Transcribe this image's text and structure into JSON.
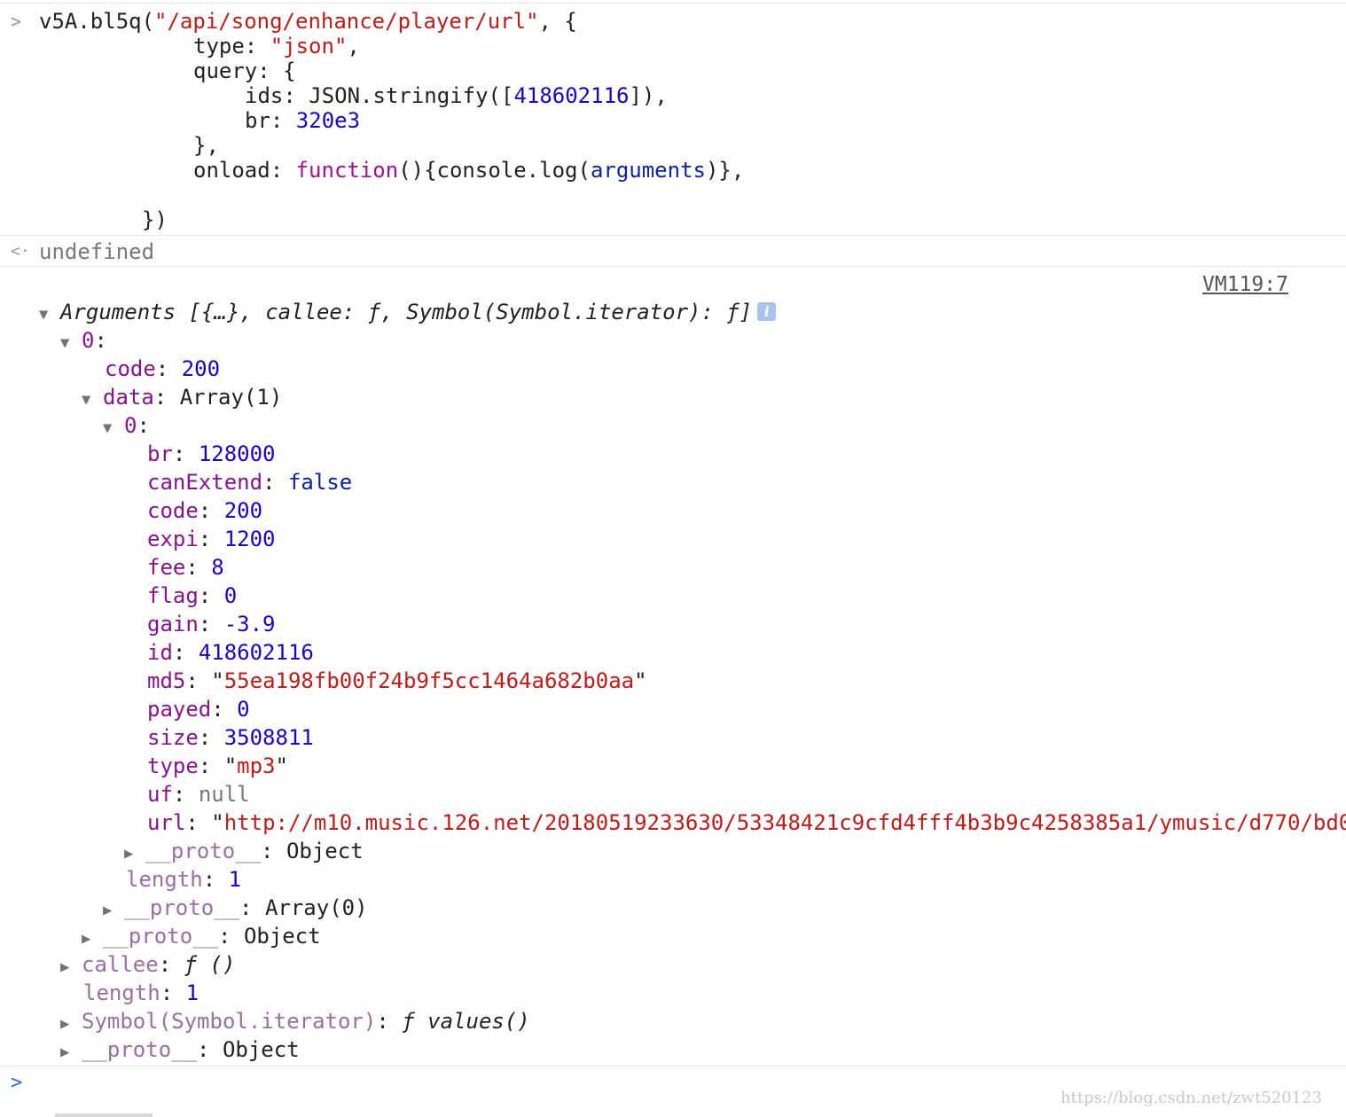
{
  "input": {
    "l1_fn": "v5A.bl5q(",
    "l1_path": "\"/api/song/enhance/player/url\"",
    "l1_end": ", {",
    "l2_key": "type: ",
    "l2_val": "\"json\"",
    "l2_end": ",",
    "l3": "query: {",
    "l4_a": "ids: JSON.stringify([",
    "l4_num": "418602116",
    "l4_b": "]),",
    "l5_key": "br: ",
    "l5_num": "320e3",
    "l6": "},",
    "l7_key": "onload: ",
    "l7_fn": "function",
    "l7_a": "(){console.log(",
    "l7_args": "arguments",
    "l7_b": ")},",
    "l8": "})"
  },
  "result": {
    "value": "undefined"
  },
  "log": {
    "source": "VM119:7",
    "summary": "Arguments [{…}, callee: ƒ, Symbol(Symbol.iterator): ƒ]",
    "info_icon": "i",
    "root_key": "0",
    "code_key": "code",
    "code_val": "200",
    "data_key": "data",
    "data_val": "Array(1)",
    "item_key": "0",
    "fields": {
      "br": "128000",
      "canExtend": "false",
      "code": "200",
      "expi": "1200",
      "fee": "8",
      "flag": "0",
      "gain": "-3.9",
      "id": "418602116",
      "md5": "55ea198fb00f24b9f5cc1464a682b0aa",
      "payed": "0",
      "size": "3508811",
      "type": "mp3",
      "uf": "null",
      "url": "http://m10.music.126.net/20180519233630/53348421c9cfd4fff4b3b9c4258385a1/ymusic/d770/bd0"
    },
    "proto_key": "__proto__",
    "item_proto_val": "Object",
    "length_key": "length",
    "data_length": "1",
    "data_proto_val": "Array(0)",
    "root_proto_val": "Object",
    "callee_key": "callee",
    "callee_val": "ƒ ()",
    "args_length": "1",
    "symbol_key": "Symbol(Symbol.iterator)",
    "symbol_val": "ƒ values()",
    "args_proto_val": "Object"
  },
  "watermark": "https://blog.csdn.net/zwt520123",
  "colors": {
    "string": "#c41a16",
    "number": "#1c00cf",
    "keyword": "#aa0d91",
    "property": "#881391",
    "prompt": "#2a6ed8"
  },
  "icons": {
    "input_prompt": "chevron-right-icon",
    "result_prompt": "return-arrow-icon",
    "expanded": "triangle-down-icon",
    "collapsed": "triangle-right-icon"
  }
}
